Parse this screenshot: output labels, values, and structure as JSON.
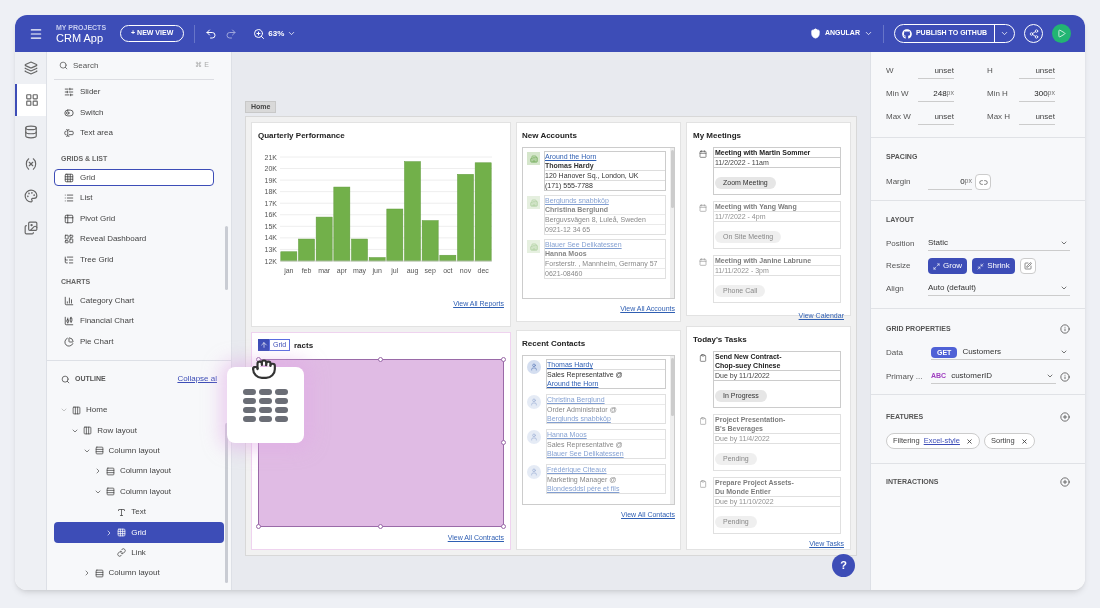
{
  "topbar": {
    "project_label": "MY PROJECTS",
    "app_name": "CRM App",
    "new_view": "+ NEW VIEW",
    "zoom": "63%",
    "framework": "ANGULAR",
    "publish": "PUBLISH TO GITHUB"
  },
  "rail": [
    {
      "selected": false
    },
    {
      "selected": true
    },
    {
      "selected": false
    },
    {
      "selected": false
    },
    {
      "selected": false
    },
    {
      "selected": false
    }
  ],
  "toolbox": {
    "search": {
      "placeholder": "Search",
      "shortcut": "⌘ E"
    },
    "groups": [
      {
        "items": [
          {
            "label": "Slider",
            "selected": false
          },
          {
            "label": "Switch",
            "selected": false
          },
          {
            "label": "Text area",
            "selected": false
          }
        ]
      },
      {
        "heading": "GRIDS & LIST",
        "items": [
          {
            "label": "Grid",
            "selected": true
          },
          {
            "label": "List",
            "selected": false
          },
          {
            "label": "Pivot Grid",
            "selected": false
          },
          {
            "label": "Reveal Dashboard",
            "selected": false
          },
          {
            "label": "Tree Grid",
            "selected": false
          }
        ]
      },
      {
        "heading": "CHARTS",
        "items": [
          {
            "label": "Category Chart",
            "selected": false
          },
          {
            "label": "Financial Chart",
            "selected": false
          },
          {
            "label": "Pie Chart",
            "selected": false
          }
        ]
      }
    ]
  },
  "outline": {
    "title": "OUTLINE",
    "collapse": "Collapse al",
    "tree": [
      {
        "label": "Home",
        "kind": "row",
        "expanded": true,
        "selected": false,
        "children": [
          {
            "label": "Row layout",
            "kind": "row",
            "expanded": true,
            "selected": false,
            "children": [
              {
                "label": "Column layout",
                "kind": "column",
                "expanded": true,
                "selected": false,
                "children": [
                  {
                    "label": "Column layout",
                    "kind": "column",
                    "expanded": false,
                    "selected": false
                  },
                  {
                    "label": "Column layout",
                    "kind": "column",
                    "expanded": true,
                    "selected": false,
                    "children": [
                      {
                        "label": "Text",
                        "kind": "text",
                        "selected": false
                      },
                      {
                        "label": "Grid",
                        "kind": "grid",
                        "expanded": false,
                        "selected": true
                      },
                      {
                        "label": "Link",
                        "kind": "link",
                        "selected": false
                      }
                    ]
                  }
                ]
              },
              {
                "label": "Column layout",
                "kind": "column",
                "expanded": false,
                "selected": false
              }
            ]
          }
        ]
      }
    ]
  },
  "page": {
    "tab": "Home",
    "performance": {
      "title": "Quarterly Performance",
      "link": "View All Reports",
      "chart_data": {
        "type": "bar",
        "categories": [
          "jan",
          "feb",
          "mar",
          "apr",
          "may",
          "jun",
          "jul",
          "aug",
          "sep",
          "oct",
          "nov",
          "dec"
        ],
        "grid": true,
        "series": [
          {
            "color": "#72b04a",
            "values": [
              12800,
              13900,
              15800,
              18400,
              13900,
              12300,
              16500,
              20600,
              15500,
              12500,
              19500,
              20500
            ]
          }
        ],
        "ylim": [
          12000,
          21000
        ],
        "yticks": [
          {
            "value": 12000,
            "label": "12K"
          },
          {
            "value": 13000,
            "label": "13K"
          },
          {
            "value": 14000,
            "label": "14K"
          },
          {
            "value": 15000,
            "label": "15K"
          },
          {
            "value": 16000,
            "label": "16K"
          },
          {
            "value": 17000,
            "label": "17K"
          },
          {
            "value": 18000,
            "label": "18K"
          },
          {
            "value": 19000,
            "label": "19K"
          },
          {
            "value": 20000,
            "label": "20K"
          },
          {
            "value": 21000,
            "label": "21K"
          }
        ]
      }
    },
    "contracts": {
      "title": "racts",
      "tag": "Grid",
      "link": "View All Contracts"
    },
    "accounts": {
      "title": "New Accounts",
      "link": "View All Accounts",
      "entries": [
        {
          "name": "Around the Horn",
          "contact": "Thomas Hardy",
          "address": "120 Hanover Sq., London, UK",
          "phone": "(171) 555-7788",
          "dimmed": false
        },
        {
          "name": "Berglunds snabbköp",
          "contact": "Christina Berglund",
          "address": "Berguvsvägen 8, Luleå, Sweden",
          "phone": "0921-12 34 65",
          "dimmed": true
        },
        {
          "name": "Blauer See Delikatessen",
          "contact": "Hanna Moos",
          "address": "Forsterstr. , Mannheim, Germany 57",
          "phone": "0621-08460",
          "dimmed": true
        }
      ]
    },
    "contacts": {
      "title": "Recent Contacts",
      "link": "View All Contacts",
      "entries": [
        {
          "name": "Thomas Hardy",
          "role": "Sales Representative @",
          "company": "Around the Horn",
          "dimmed": false
        },
        {
          "name": "Christina Berglund",
          "role": "Order Administrator @",
          "company": "Berglunds snabbköp",
          "dimmed": true
        },
        {
          "name": "Hanna Moos",
          "role": "Sales Representative @",
          "company": "Blauer See Delikatessen",
          "dimmed": true
        },
        {
          "name": "Frédérique Citeaux",
          "role": "Marketing Manager @",
          "company": "Blondesddsl père et fils",
          "dimmed": true
        }
      ]
    },
    "meetings": {
      "title": "My Meetings",
      "link": "View Calendar",
      "entries": [
        {
          "title": "Meeting with Martin Sommer",
          "date": "11/2/2022 - 11am",
          "action": "Zoom Meeting",
          "dimmed": false
        },
        {
          "title": "Meeting with Yang Wang",
          "date": "11/7/2022 - 4pm",
          "action": "On Site Meeting",
          "dimmed": true
        },
        {
          "title": "Meeting with Janine Labrune",
          "date": "11/11/2022 - 3pm",
          "action": "Phone Call",
          "dimmed": true
        }
      ]
    },
    "tasks": {
      "title": "Today's Tasks",
      "link": "View Tasks",
      "entries": [
        {
          "title_lines": [
            "Send New Contract-",
            "Chop-suey Chinese"
          ],
          "due": "Due by 11/1/2022",
          "status": "In Progress",
          "dimmed": false
        },
        {
          "title_lines": [
            "Project Presentation-",
            "B's Beverages"
          ],
          "due": "Due by 11/4/2022",
          "status": "Pending",
          "dimmed": true
        },
        {
          "title_lines": [
            "Prepare Project Assets-",
            "Du Monde Entier"
          ],
          "due": "Due by 11/10/2022",
          "status": "Pending",
          "dimmed": true
        }
      ]
    },
    "help": "?"
  },
  "properties": {
    "size": [
      {
        "label": "W",
        "value": "unset"
      },
      {
        "label": "H",
        "value": "unset"
      },
      {
        "label": "Min W",
        "value": "248",
        "unit": "px"
      },
      {
        "label": "Min H",
        "value": "300",
        "unit": "px"
      },
      {
        "label": "Max W",
        "value": "unset"
      },
      {
        "label": "Max H",
        "value": "unset"
      }
    ],
    "spacing": {
      "heading": "SPACING",
      "label": "Margin",
      "value": "0",
      "unit": "px"
    },
    "layout": {
      "heading": "LAYOUT",
      "position_label": "Position",
      "position": "Static",
      "resize_label": "Resize",
      "grow": "Grow",
      "shrink": "Shrink",
      "align_label": "Align",
      "align": "Auto (default)"
    },
    "grid": {
      "heading": "GRID PROPERTIES",
      "data_label": "Data",
      "method": "GET",
      "data": "Customers",
      "primary_label": "Primary ...",
      "type": "ABC",
      "primary": "customerID"
    },
    "features": {
      "heading": "FEATURES",
      "chips": [
        {
          "label": "Filtering",
          "link": "Excel-style"
        },
        {
          "label": "Sorting"
        }
      ]
    },
    "interactions": {
      "heading": "INTERACTIONS"
    }
  }
}
